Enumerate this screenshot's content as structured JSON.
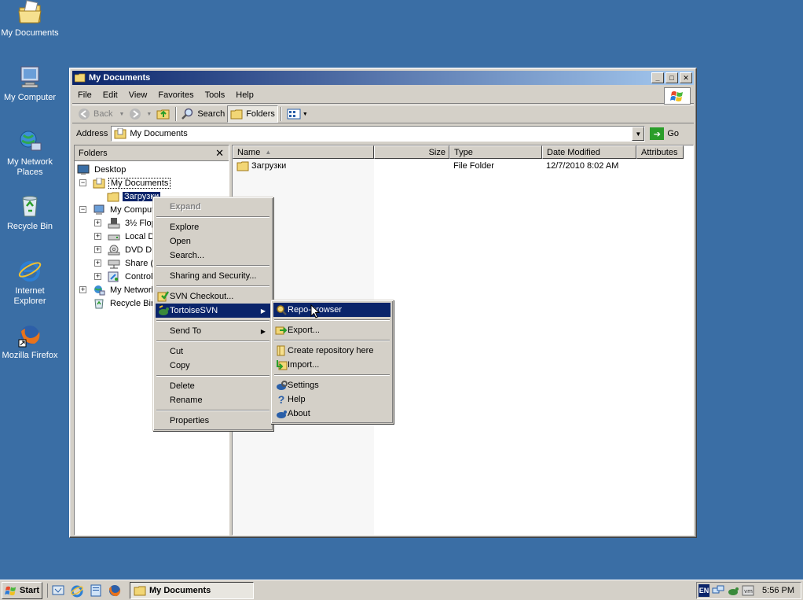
{
  "desktop": {
    "icons": [
      {
        "label": "My Documents",
        "icon": "my-documents-icon"
      },
      {
        "label": "My Computer",
        "icon": "my-computer-icon"
      },
      {
        "label": "My Network Places",
        "icon": "network-places-icon"
      },
      {
        "label": "Recycle Bin",
        "icon": "recycle-bin-icon"
      },
      {
        "label": "Internet Explorer",
        "icon": "internet-explorer-icon"
      },
      {
        "label": "Mozilla Firefox",
        "icon": "firefox-icon"
      }
    ]
  },
  "window": {
    "title": "My Documents",
    "menu": [
      "File",
      "Edit",
      "View",
      "Favorites",
      "Tools",
      "Help"
    ],
    "toolbar": {
      "back": "Back",
      "search": "Search",
      "folders": "Folders"
    },
    "address": {
      "label": "Address",
      "value": "My Documents",
      "go": "Go"
    }
  },
  "folders_pane": {
    "title": "Folders",
    "items": [
      {
        "label": "Desktop"
      },
      {
        "label": "My Documents"
      },
      {
        "label": "Загрузки"
      },
      {
        "label": "My Compute"
      },
      {
        "label": "3½ Flop"
      },
      {
        "label": "Local Dis"
      },
      {
        "label": "DVD Driv"
      },
      {
        "label": "Share (E"
      },
      {
        "label": "Control"
      },
      {
        "label": "My Network"
      },
      {
        "label": "Recycle Bin"
      }
    ]
  },
  "file_list": {
    "columns": [
      "Name",
      "Size",
      "Type",
      "Date Modified",
      "Attributes"
    ],
    "rows": [
      {
        "name": "Загрузки",
        "size": "",
        "type": "File Folder",
        "modified": "12/7/2010 8:02 AM",
        "attributes": ""
      }
    ]
  },
  "context_menu": {
    "items": [
      "Expand",
      "Explore",
      "Open",
      "Search...",
      "Sharing and Security...",
      "SVN Checkout...",
      "TortoiseSVN",
      "Send To",
      "Cut",
      "Copy",
      "Delete",
      "Rename",
      "Properties"
    ]
  },
  "submenu": {
    "items": [
      "Repo-browser",
      "Export...",
      "Create repository here",
      "Import...",
      "Settings",
      "Help",
      "About"
    ]
  },
  "taskbar": {
    "start": "Start",
    "task": "My Documents",
    "lang": "EN",
    "clock": "5:56 PM"
  },
  "colors": {
    "desktop": "#3a6ea5",
    "title_active": "#0a246a",
    "face": "#d4d0c8",
    "highlight": "#0a246a"
  }
}
